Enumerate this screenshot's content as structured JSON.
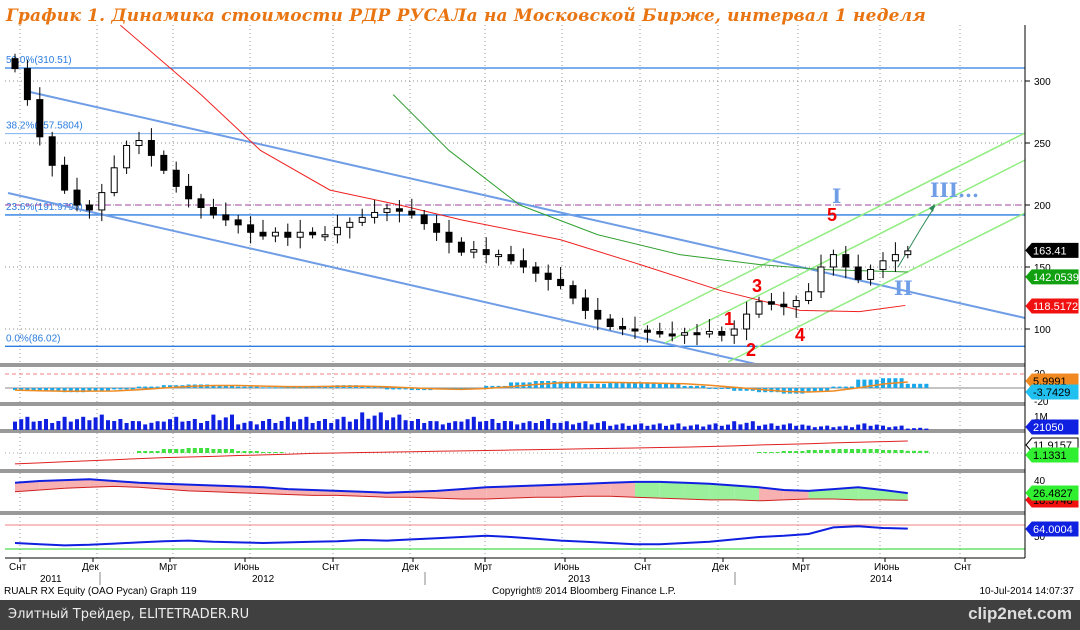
{
  "title": "График 1. Динамика стоимости РДР РУСАЛа на Московской Бирже, интервал 1 неделя",
  "footer": {
    "ticker": "RUALR RX Equity (OAO Pycan) Graph 119",
    "copyright": "Copyright® 2014 Bloomberg Finance L.P.",
    "timestamp": "10-Jul-2014 14:07:37",
    "source": "Элитный Трейдер, ELITETRADER.RU",
    "logo": "clip2net.com"
  },
  "chart_data": {
    "type": "candlestick",
    "title": "График 1. Динамика стоимости РДР РУСАЛа на Московской Бирже, интервал 1 неделя",
    "interval": "1 week (sampled every 2 weeks)",
    "x_month_ticks": [
      "Снт",
      "Дек",
      "Мрт",
      "Июнь",
      "Снт",
      "Дек",
      "Мрт",
      "Июнь",
      "Снт",
      "Дек",
      "Мрт",
      "Июнь",
      "Снт"
    ],
    "x_year_labels": [
      "2011",
      "2012",
      "2013",
      "2014"
    ],
    "y_ticks": [
      100,
      150,
      200,
      250,
      300
    ],
    "ylim": [
      80,
      340
    ],
    "close": [
      310,
      285,
      255,
      232,
      212,
      200,
      196,
      210,
      230,
      248,
      252,
      240,
      228,
      215,
      205,
      198,
      192,
      188,
      184,
      178,
      175,
      178,
      174,
      178,
      176,
      176,
      182,
      186,
      190,
      194,
      197,
      195,
      192,
      185,
      178,
      170,
      162,
      164,
      160,
      160,
      155,
      150,
      145,
      140,
      135,
      125,
      115,
      108,
      102,
      100,
      99,
      98,
      96,
      95,
      97,
      96,
      98,
      95,
      100,
      112,
      122,
      120,
      118,
      123,
      130,
      150,
      160,
      150,
      140,
      148,
      155,
      160,
      163
    ],
    "ma_red": [
      [
        8.5,
        345
      ],
      [
        15,
        289
      ],
      [
        19.8,
        244
      ],
      [
        25.4,
        212
      ],
      [
        31,
        200
      ],
      [
        36,
        188
      ],
      [
        44,
        172
      ],
      [
        50.4,
        152
      ],
      [
        56.9,
        131
      ],
      [
        63.3,
        115
      ],
      [
        68.1,
        114
      ],
      [
        71.8,
        119
      ]
    ],
    "ma_green": [
      [
        30.5,
        289
      ],
      [
        35,
        244
      ],
      [
        40.7,
        200
      ],
      [
        47,
        176
      ],
      [
        53.6,
        160
      ],
      [
        60,
        152
      ],
      [
        65,
        148
      ],
      [
        72,
        146
      ]
    ],
    "fib_levels": [
      {
        "label": "50.0%(310.51)",
        "value": 310.51
      },
      {
        "label": "38.2%(257.5804)",
        "value": 257.5804
      },
      {
        "label": "23.6%(191.9795)",
        "value": 191.9795
      },
      {
        "label": "0.0%(86.02)",
        "value": 86.02
      }
    ],
    "target_level": 200,
    "last_values": {
      "price": "163.41",
      "ma_green": "142.0539",
      "ma_red": "118.5172"
    },
    "wave_labels": {
      "w1": "1",
      "w2": "2",
      "w3": "3",
      "w4": "4",
      "w5": "5",
      "I": "I",
      "II": "II",
      "III": "III..."
    },
    "panels": {
      "macd": {
        "ticks": [
          "20",
          "-20"
        ],
        "hist": [
          -3,
          -5,
          -6,
          -4,
          -2,
          2,
          4,
          5,
          3,
          2,
          1,
          2,
          3,
          4,
          2,
          -2,
          -3,
          -2,
          -1,
          3,
          8,
          10,
          9,
          6,
          7,
          8,
          6,
          3,
          -1,
          -4,
          -6,
          -8,
          -5,
          2,
          12,
          14,
          6
        ],
        "last": "-3.7429",
        "last_signal": "5.9991"
      },
      "volume": {
        "ticks": [
          "1M"
        ],
        "values_m": [
          0.6,
          0.5,
          0.6,
          0.7,
          0.5,
          0.4,
          0.6,
          0.5,
          0.7,
          0.4,
          0.5,
          0.6,
          0.5,
          0.6,
          0.8,
          0.7,
          0.5,
          0.4,
          0.6,
          0.5,
          0.4,
          0.5,
          0.4,
          0.4,
          0.3,
          0.3,
          0.3,
          0.25,
          0.3,
          0.4,
          0.3,
          0.3,
          0.2,
          0.2,
          0.3,
          0.2,
          0.1
        ],
        "last": "21050"
      },
      "momentum": {
        "red": [
          1,
          1.5,
          2,
          2.5,
          3,
          3.5,
          4,
          4.3,
          4.6,
          5,
          5.3,
          5.6,
          6,
          6.2,
          6.4,
          6.6,
          6.8,
          7,
          7.2,
          7.4,
          7.6,
          7.8,
          8,
          8.2,
          8.4,
          8.6,
          8.8,
          9,
          9.3,
          9.6,
          10,
          10.3,
          10.6,
          11,
          11.3,
          11.6,
          11.9
        ],
        "green": [
          0,
          0,
          0,
          0,
          0,
          1,
          2,
          2.5,
          2,
          1,
          0.5,
          0,
          0,
          0,
          0,
          0,
          0,
          0,
          0,
          0,
          0,
          0,
          0,
          0,
          0,
          0,
          0,
          0,
          0,
          0,
          0.5,
          1,
          1.5,
          2,
          2,
          1.5,
          1.1
        ],
        "last_red": "11.9157",
        "last_green": "1.1331"
      },
      "dmi": {
        "ticks": [
          "40"
        ],
        "blue": [
          38,
          40,
          41,
          42,
          40,
          38,
          37,
          36,
          35,
          34,
          33,
          31,
          30,
          29,
          28,
          27,
          28,
          29,
          31,
          33,
          34,
          35,
          36,
          37,
          38,
          39,
          39,
          38,
          37,
          35,
          33,
          30,
          29,
          31,
          33,
          30,
          26.5
        ],
        "red": [
          28,
          30,
          32,
          33,
          34,
          33,
          31,
          29,
          28,
          27,
          26,
          25,
          24,
          24,
          23,
          22,
          22,
          21,
          20,
          20,
          21,
          22,
          22,
          23,
          23,
          22,
          21,
          20,
          19,
          19,
          18,
          19,
          20,
          20,
          19,
          19,
          18.6
        ],
        "last_blue": "26.4827",
        "last_red": "18.5748"
      },
      "rsi": {
        "ticks": [
          "50"
        ],
        "levels": [
          70,
          30
        ],
        "values": [
          40,
          38,
          36,
          37,
          39,
          41,
          43,
          44,
          42,
          41,
          40,
          41,
          42,
          43,
          45,
          44,
          46,
          48,
          50,
          52,
          50,
          47,
          44,
          42,
          40,
          38,
          38,
          40,
          42,
          46,
          50,
          52,
          55,
          66,
          68,
          65,
          64
        ],
        "last": "64.0004"
      }
    }
  }
}
